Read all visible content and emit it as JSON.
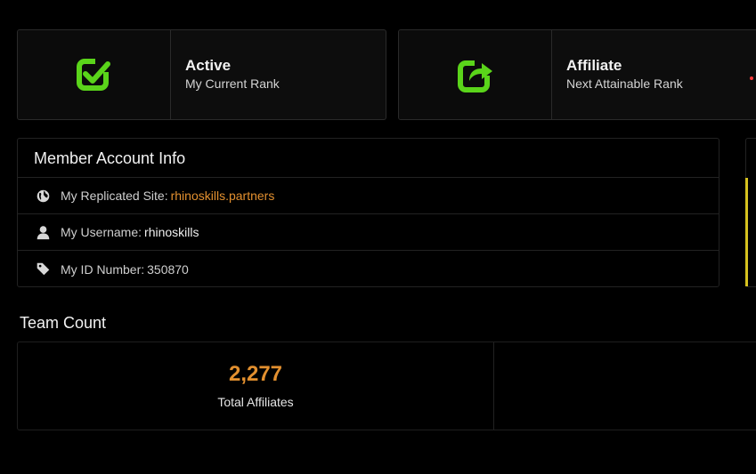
{
  "rank_cards": [
    {
      "title": "Active",
      "subtitle": "My Current Rank",
      "icon": "check-square-icon",
      "icon_color": "#5ad41a"
    },
    {
      "title": "Affiliate",
      "subtitle": "Next Attainable Rank",
      "icon": "share-square-icon",
      "icon_color": "#5ad41a"
    }
  ],
  "account_info": {
    "title": "Member Account Info",
    "rows": [
      {
        "label": "My Replicated Site:",
        "value": "rhinoskills.partners",
        "icon": "globe-icon"
      },
      {
        "label": "My Username:",
        "value": "rhinoskills",
        "icon": "user-icon"
      },
      {
        "label": "My ID Number:",
        "value": "350870",
        "icon": "tag-icon"
      }
    ]
  },
  "team_count": {
    "title": "Team Count",
    "stats": [
      {
        "value": "2,277",
        "label": "Total Affiliates"
      }
    ]
  },
  "colors": {
    "accent_orange": "#e3902f",
    "icon_green": "#5ad41a",
    "side_accent": "#d6c21f"
  }
}
